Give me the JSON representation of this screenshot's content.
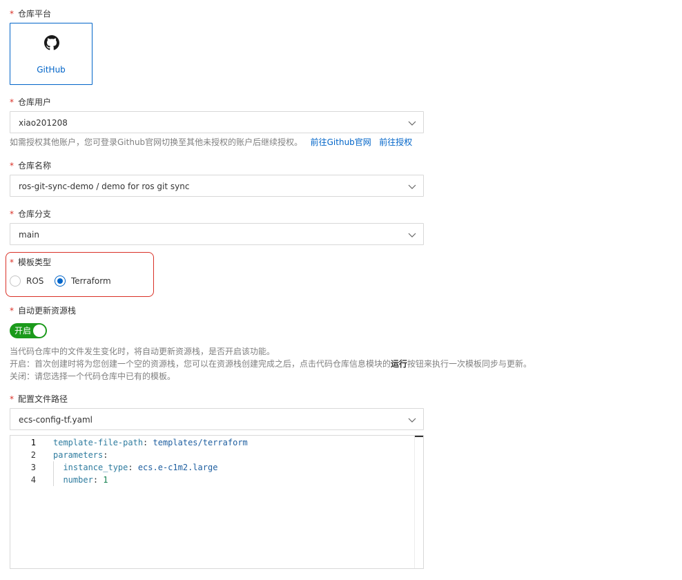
{
  "platform": {
    "label": "仓库平台",
    "option": "GitHub",
    "icon": "github-icon"
  },
  "user": {
    "label": "仓库用户",
    "value": "xiao201208",
    "hint": "如需授权其他账户，您可登录Github官网切换至其他未授权的账户后继续授权。",
    "link_official": "前往Github官网",
    "link_auth": "前往授权"
  },
  "repo": {
    "label": "仓库名称",
    "value": "ros-git-sync-demo / demo for ros git sync"
  },
  "branch": {
    "label": "仓库分支",
    "value": "main"
  },
  "template_type": {
    "label": "模板类型",
    "options": [
      "ROS",
      "Terraform"
    ],
    "selected": "Terraform"
  },
  "auto_update": {
    "label": "自动更新资源栈",
    "switch_text": "开启",
    "enabled": true,
    "desc1": "当代码仓库中的文件发生变化时，将自动更新资源栈，是否开启该功能。",
    "desc2_prefix": "开启：首次创建时将为您创建一个空的资源栈，您可以在资源栈创建完成之后，点击代码仓库信息模块的",
    "desc2_bold": "运行",
    "desc2_suffix": "按钮来执行一次模板同步与更新。",
    "desc3": "关闭：请您选择一个代码仓库中已有的模板。"
  },
  "config_path": {
    "label": "配置文件路径",
    "value": "ecs-config-tf.yaml"
  },
  "editor": {
    "line_numbers": [
      "1",
      "2",
      "3",
      "4"
    ],
    "lines": [
      {
        "key": "template-file-path",
        "sep": ": ",
        "value": "templates/terraform",
        "value_type": "str",
        "indent": ""
      },
      {
        "key": "parameters",
        "sep": ":",
        "value": "",
        "value_type": "str",
        "indent": ""
      },
      {
        "key": "instance_type",
        "sep": ": ",
        "value": "ecs.e-c1m2.large",
        "value_type": "str",
        "indent": "  "
      },
      {
        "key": "number",
        "sep": ": ",
        "value": "1",
        "value_type": "num",
        "indent": "  "
      }
    ]
  },
  "required_mark": "*",
  "colors": {
    "accent": "#0064c8",
    "required": "#d93026",
    "switch_on": "#1b9a1b",
    "highlight_border": "#d93026"
  }
}
